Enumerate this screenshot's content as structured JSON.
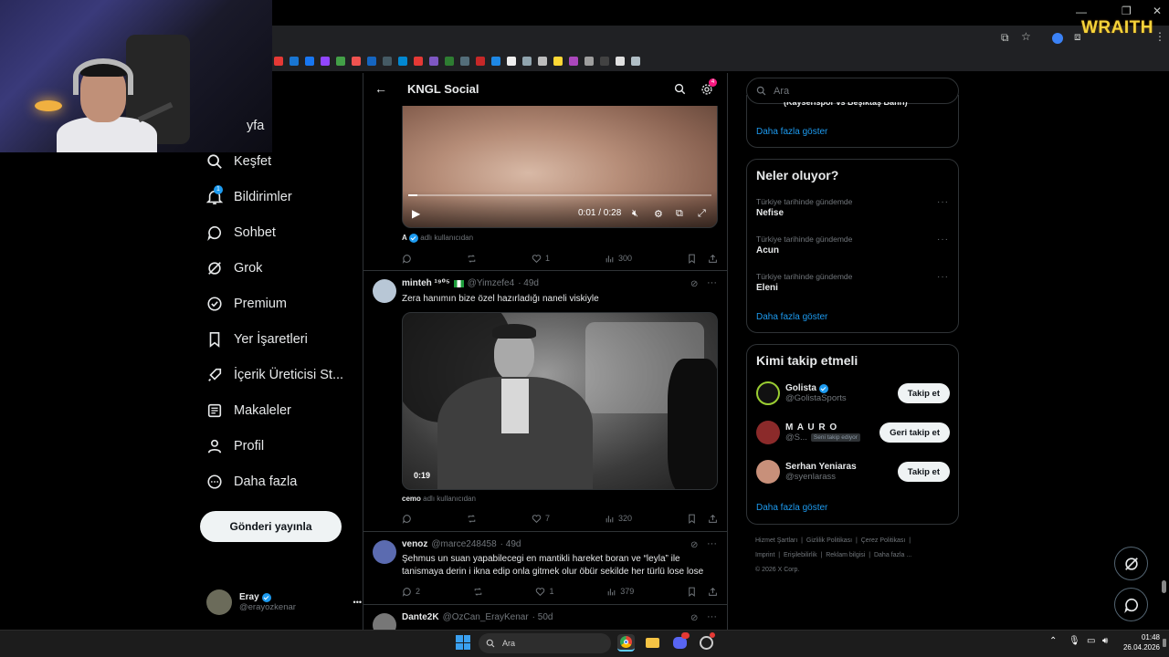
{
  "overlay": {
    "brand": "WRAITH"
  },
  "sidebar": {
    "items": [
      {
        "label": "yfa",
        "icon": "home-icon"
      },
      {
        "label": "Keşfet",
        "icon": "search-icon"
      },
      {
        "label": "Bildirimler",
        "icon": "bell-icon",
        "badge": "1"
      },
      {
        "label": "Sohbet",
        "icon": "chat-icon"
      },
      {
        "label": "Grok",
        "icon": "grok-icon"
      },
      {
        "label": "Premium",
        "icon": "premium-icon"
      },
      {
        "label": "Yer İşaretleri",
        "icon": "bookmark-icon"
      },
      {
        "label": "İçerik Üreticisi St...",
        "icon": "rocket-icon"
      },
      {
        "label": "Makaleler",
        "icon": "article-icon"
      },
      {
        "label": "Profil",
        "icon": "person-icon"
      },
      {
        "label": "Daha fazla",
        "icon": "more-circle-icon"
      }
    ],
    "post_button": "Gönderi yayınla",
    "profile": {
      "name": "Eray",
      "handle": "@erayozkenar",
      "menu": "•••"
    }
  },
  "main": {
    "title": "KNGL Social",
    "settings_badge": "4",
    "posts": [
      {
        "video_time": "0:01 / 0:28",
        "reply_note_user": "A",
        "reply_note_text": "adlı kullanıcıdan",
        "likes": "1",
        "views": "300"
      },
      {
        "name": "minteh ¹⁹⁰⁵",
        "handle": "@Yimzefe4",
        "time": "· 49d",
        "text": "Zera hanımın bize özel hazırladığı naneli viskiyle",
        "video_duration": "0:19",
        "reply_note_user": "cemo",
        "reply_note_text": "adlı kullanıcıdan",
        "likes": "7",
        "views": "320"
      },
      {
        "name": "venoz",
        "handle": "@marce248458",
        "time": "· 49d",
        "text": "Şehmus un suan yapabilecegi en mantikli hareket boran ve “leyla” ile tanismaya derin i ikna edip onla gitmek olur öbür sekilde her türlü lose lose",
        "replies": "2",
        "likes": "1",
        "views": "379"
      },
      {
        "name": "Dante2K",
        "handle": "@OzCan_ErayKenar",
        "time": "· 50d"
      }
    ]
  },
  "right": {
    "search_placeholder": "Ara",
    "top_card_partial": "(Kayserispor vs Beşiktaş Bahri)",
    "top_card_more": "Daha fazla göster",
    "trends_title": "Neler oluyor?",
    "trends": [
      {
        "category": "Türkiye tarihinde gündemde",
        "name": "Nefise"
      },
      {
        "category": "Türkiye tarihinde gündemde",
        "name": "Acun"
      },
      {
        "category": "Türkiye tarihinde gündemde",
        "name": "Eleni"
      }
    ],
    "trends_more": "Daha fazla göster",
    "who_title": "Kimi takip etmeli",
    "who": [
      {
        "name": "Golista",
        "handle": "@GolistaSports",
        "button": "Takip et",
        "verified": true
      },
      {
        "name": "M A U R O",
        "handle": "@S...",
        "badge": "Seni takip ediyor",
        "button": "Geri takip et"
      },
      {
        "name": "Serhan Yeniaras",
        "handle": "@syenlarass",
        "button": "Takip et"
      }
    ],
    "who_more": "Daha fazla göster",
    "footer": [
      "Hizmet Şartları",
      "Gizlilik Politikası",
      "Çerez Politikası",
      "Imprint",
      "Erişilebilirlik",
      "Reklam bilgisi",
      "Daha fazla ...",
      "© 2026 X Corp."
    ]
  },
  "taskbar": {
    "search": "Ara",
    "time": "01:48",
    "date": "26.04.2026"
  },
  "colors": {
    "accent": "#1d9bf0",
    "background": "#000000",
    "border": "#2f3336"
  }
}
